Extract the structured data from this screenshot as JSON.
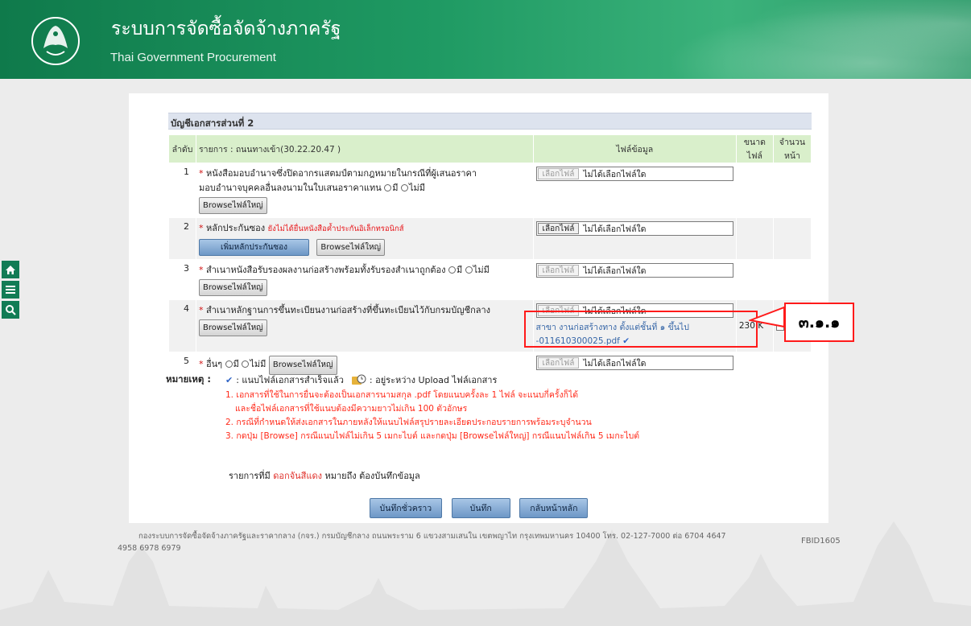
{
  "header": {
    "title": "ระบบการจัดซื้อจัดจ้างภาครัฐ",
    "subtitle": "Thai Government Procurement",
    "logo_icon": "government-seal-icon"
  },
  "sidenav": [
    "home-icon",
    "menu-icon",
    "search-icon"
  ],
  "section": {
    "title": "บัญชีเอกสารส่วนที่ 2",
    "columns": {
      "no": "ลำดับ",
      "item": "รายการ : ถนนทางเข้า(30.22.20.47 )",
      "file": "ไฟล์ข้อมูล",
      "size": "ขนาด ไฟล์",
      "pages": "จำนวน หน้า"
    }
  },
  "rows": [
    {
      "no": "1",
      "line1": "หนังสือมอบอำนาจซึ่งปิดอากรแสตมป์ตามกฎหมายในกรณีที่ผู้เสนอราคา",
      "line2": "มอบอำนาจบุคคลอื่นลงนามในใบเสนอราคาแทน",
      "opt_yes": "มี",
      "opt_no": "ไม่มี",
      "browse": "Browseไฟล์ใหญ่",
      "choose": "เลือกไฟล์",
      "nofile": "ไม่ได้เลือกไฟล์ใด"
    },
    {
      "no": "2",
      "line1": "หลักประกันซอง",
      "warn": "ยังไม่ได้ยื่นหนังสือค้ำประกันอิเล็กทรอนิกส์",
      "add_guarantee": "เพิ่มหลักประกันซอง",
      "browse": "Browseไฟล์ใหญ่",
      "choose": "เลือกไฟล์",
      "nofile": "ไม่ได้เลือกไฟล์ใด"
    },
    {
      "no": "3",
      "line1": "สำเนาหนังสือรับรองผลงานก่อสร้างพร้อมทั้งรับรองสำเนาถูกต้อง",
      "opt_yes": "มี",
      "opt_no": "ไม่มี",
      "browse": "Browseไฟล์ใหญ่",
      "choose": "เลือกไฟล์",
      "nofile": "ไม่ได้เลือกไฟล์ใด"
    },
    {
      "no": "4",
      "line1": "สำเนาหลักฐานการขึ้นทะเบียนงานก่อสร้างที่ขึ้นทะเบียนไว้กับกรมบัญชีกลาง",
      "browse": "Browseไฟล์ใหญ่",
      "choose": "เลือกไฟล์",
      "nofile": "ไม่ได้เลือกไฟล์ใด",
      "uploaded_line1": "สาขา งานก่อสร้างทาง ตั้งแต่ชั้นที่ ๑ ขึ้นไป",
      "uploaded_line2": "-011610300025.pdf",
      "size": "230 K"
    },
    {
      "no": "5",
      "line1": "อื่นๆ",
      "opt_yes": "มี",
      "opt_no": "ไม่มี",
      "browse": "Browseไฟล์ใหญ่",
      "choose": "เลือกไฟล์",
      "nofile": "ไม่ได้เลือกไฟล์ใด"
    }
  ],
  "annotation": "๓.๑.๑",
  "notes": {
    "label": "หมายเหตุ :",
    "attached": ": แนบไฟล์เอกสารสำเร็จแล้ว",
    "uploading": ": อยู่ระหว่าง Upload ไฟล์เอกสาร",
    "n1a": "1. เอกสารที่ใช้ในการยื่นจะต้องเป็นเอกสารนามสกุล .pdf โดยแนบครั้งละ 1 ไฟล์ จะแนบกี่ครั้งก็ได้",
    "n1b": "และชื่อไฟล์เอกสารที่ใช้แนบต้องมีความยาวไม่เกิน 100 ตัวอักษร",
    "n2": "2. กรณีที่กำหนดให้ส่งเอกสารในภายหลังให้แนบไฟล์สรุปรายละเอียดประกอบรายการพร้อมระบุจำนวน",
    "n3": "3. กดปุ่ม [Browse] กรณีแนบไฟล์ไม่เกิน 5 เมกะไบต์ และกดปุ่ม [Browseไฟล์ใหญ่] กรณีแนบไฟล์เกิน 5 เมกะไบต์"
  },
  "required_line": {
    "pre": "รายการที่มี",
    "red": "ดอกจันสีแดง",
    "post": "หมายถึง ต้องบันทึกข้อมูล"
  },
  "buttons": {
    "draft": "บันทึกชั่วคราว",
    "save": "บันทึก",
    "back": "กลับหน้าหลัก"
  },
  "footer": {
    "text": "กองระบบการจัดซื้อจัดจ้างภาครัฐและราคากลาง (กจร.) กรมบัญชีกลาง ถนนพระราม 6 แขวงสามเสนใน เขตพญาไท กรุงเทพมหานคร 10400 โทร. 02-127-7000 ต่อ 6704 4647",
    "text2": "4958 6978 6979",
    "fbid": "FBID1605"
  }
}
